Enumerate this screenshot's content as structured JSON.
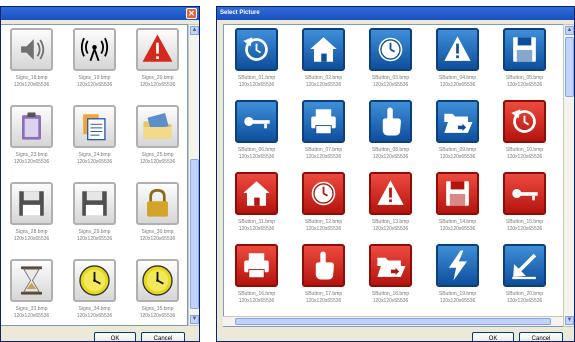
{
  "left_dialog": {
    "ok_label": "OK",
    "cancel_label": "Cancel",
    "items": [
      {
        "name": "Signs_18.bmp",
        "size": "120x120x65536",
        "icon": "speaker-icon",
        "style": "gray"
      },
      {
        "name": "Signs_19.bmp",
        "size": "120x120x65536",
        "icon": "wireless-antenna-icon",
        "style": "gray"
      },
      {
        "name": "Signs_20.bmp",
        "size": "120x120x65536",
        "icon": "warning-triangle-icon",
        "style": "gray"
      },
      {
        "name": "Signs_23.bmp",
        "size": "120x120x65536",
        "icon": "clipboard-icon",
        "style": "gray"
      },
      {
        "name": "Signs_24.bmp",
        "size": "120x120x65536",
        "icon": "documents-icon",
        "style": "gray"
      },
      {
        "name": "Signs_25.bmp",
        "size": "120x120x65536",
        "icon": "folder-icon",
        "style": "gray"
      },
      {
        "name": "Signs_28.bmp",
        "size": "120x120x65536",
        "icon": "floppy-disk-icon",
        "style": "gray"
      },
      {
        "name": "Signs_29.bmp",
        "size": "120x120x65536",
        "icon": "floppy-disk-icon",
        "style": "gray"
      },
      {
        "name": "Signs_30.bmp",
        "size": "120x120x65536",
        "icon": "padlock-icon",
        "style": "gray"
      },
      {
        "name": "Signs_33.bmp",
        "size": "120x120x65536",
        "icon": "hourglass-icon",
        "style": "gray"
      },
      {
        "name": "Signs_34.bmp",
        "size": "120x120x65536",
        "icon": "clock-icon",
        "style": "gray"
      },
      {
        "name": "Signs_35.bmp",
        "size": "120x120x65536",
        "icon": "clock-icon",
        "style": "gray"
      }
    ]
  },
  "right_dialog": {
    "title": "Select Picture",
    "ok_label": "OK",
    "cancel_label": "Cancel",
    "items": [
      {
        "name": "SButton_01.bmp",
        "size": "120x120x65536",
        "icon": "reset-icon",
        "style": "blue"
      },
      {
        "name": "SButton_02.bmp",
        "size": "120x120x65536",
        "icon": "home-icon",
        "style": "blue"
      },
      {
        "name": "SButton_03.bmp",
        "size": "120x120x65536",
        "icon": "clock-icon",
        "style": "blue"
      },
      {
        "name": "SButton_04.bmp",
        "size": "120x120x65536",
        "icon": "warning-icon",
        "style": "blue"
      },
      {
        "name": "SButton_05.bmp",
        "size": "120x120x65536",
        "icon": "floppy-disk-icon",
        "style": "blue"
      },
      {
        "name": "SButton_06.bmp",
        "size": "120x120x65536",
        "icon": "key-icon",
        "style": "blue"
      },
      {
        "name": "SButton_07.bmp",
        "size": "120x120x65536",
        "icon": "printer-icon",
        "style": "blue"
      },
      {
        "name": "SButton_08.bmp",
        "size": "120x120x65536",
        "icon": "hand-pointer-icon",
        "style": "blue"
      },
      {
        "name": "SButton_09.bmp",
        "size": "120x120x65536",
        "icon": "open-folder-icon",
        "style": "blue"
      },
      {
        "name": "SButton_10.bmp",
        "size": "120x120x65536",
        "icon": "reset-icon",
        "style": "red"
      },
      {
        "name": "SButton_11.bmp",
        "size": "120x120x65536",
        "icon": "home-icon",
        "style": "red"
      },
      {
        "name": "SButton_12.bmp",
        "size": "120x120x65536",
        "icon": "clock-icon",
        "style": "red"
      },
      {
        "name": "SButton_13.bmp",
        "size": "120x120x65536",
        "icon": "warning-icon",
        "style": "red"
      },
      {
        "name": "SButton_14.bmp",
        "size": "120x120x65536",
        "icon": "floppy-disk-icon",
        "style": "red"
      },
      {
        "name": "SButton_15.bmp",
        "size": "120x120x65536",
        "icon": "key-icon",
        "style": "red"
      },
      {
        "name": "SButton_16.bmp",
        "size": "120x120x65536",
        "icon": "printer-icon",
        "style": "red"
      },
      {
        "name": "SButton_17.bmp",
        "size": "120x120x65536",
        "icon": "hand-pointer-icon",
        "style": "red"
      },
      {
        "name": "SButton_18.bmp",
        "size": "120x120x65536",
        "icon": "open-folder-icon",
        "style": "red"
      },
      {
        "name": "SButton_19.bmp",
        "size": "120x120x65536",
        "icon": "lightning-icon",
        "style": "blue"
      },
      {
        "name": "SButton_20.bmp",
        "size": "120x120x65536",
        "icon": "arrow-down-left-icon",
        "style": "blue"
      }
    ]
  }
}
